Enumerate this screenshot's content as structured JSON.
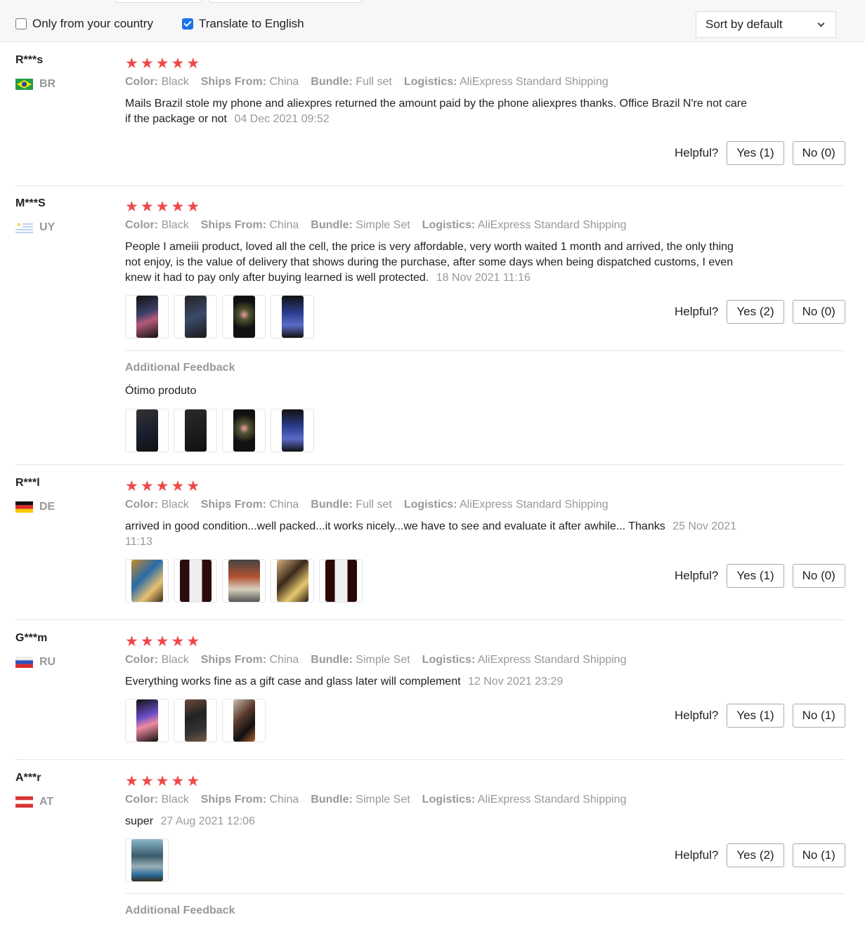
{
  "filters": {
    "only_country": {
      "label": "Only from your country",
      "checked": false
    },
    "translate": {
      "label": "Translate to English",
      "checked": true
    },
    "sort": {
      "value": "Sort by default"
    }
  },
  "spec_labels": {
    "color": "Color:",
    "ships": "Ships From:",
    "bundle": "Bundle:",
    "logistics": "Logistics:"
  },
  "helpful_label": "Helpful?",
  "additional_label": "Additional Feedback",
  "reviews": [
    {
      "user": "R***s",
      "country": "BR",
      "color": "Black",
      "ships": "China",
      "bundle": "Full set",
      "logistics": "AliExpress Standard Shipping",
      "text": "Mails Brazil stole my phone and aliexpres returned the amount paid by the phone aliexpres thanks. Office Brazil N're not care if the package or not",
      "date": "04 Dec 2021 09:52",
      "yes": "Yes (1)",
      "no": "No (0)"
    },
    {
      "user": "M***S",
      "country": "UY",
      "color": "Black",
      "ships": "China",
      "bundle": "Simple Set",
      "logistics": "AliExpress Standard Shipping",
      "text": "People I ameiii product, loved all the cell, the price is very affordable, very worth waited 1 month and arrived, the only thing not enjoy, is the value of delivery that shows during the purchase, after some days when being dispatched customs, I even knew it had to pay only after buying learned is well protected.",
      "date": "18 Nov 2021 11:16",
      "yes": "Yes (2)",
      "no": "No (0)",
      "additional_text": "Ótimo produto"
    },
    {
      "user": "R***l",
      "country": "DE",
      "color": "Black",
      "ships": "China",
      "bundle": "Full set",
      "logistics": "AliExpress Standard Shipping",
      "text": "arrived in good condition...well packed...it works nicely...we have to see and evaluate it after awhile... Thanks",
      "date": "25 Nov 2021 11:13",
      "yes": "Yes (1)",
      "no": "No (0)"
    },
    {
      "user": "G***m",
      "country": "RU",
      "color": "Black",
      "ships": "China",
      "bundle": "Simple Set",
      "logistics": "AliExpress Standard Shipping",
      "text": "Everything works fine as a gift case and glass later will complement",
      "date": "12 Nov 2021 23:29",
      "yes": "Yes (1)",
      "no": "No (1)"
    },
    {
      "user": "A***r",
      "country": "AT",
      "color": "Black",
      "ships": "China",
      "bundle": "Simple Set",
      "logistics": "AliExpress Standard Shipping",
      "text": "super",
      "date": "27 Aug 2021 12:06",
      "yes": "Yes (2)",
      "no": "No (1)"
    }
  ]
}
